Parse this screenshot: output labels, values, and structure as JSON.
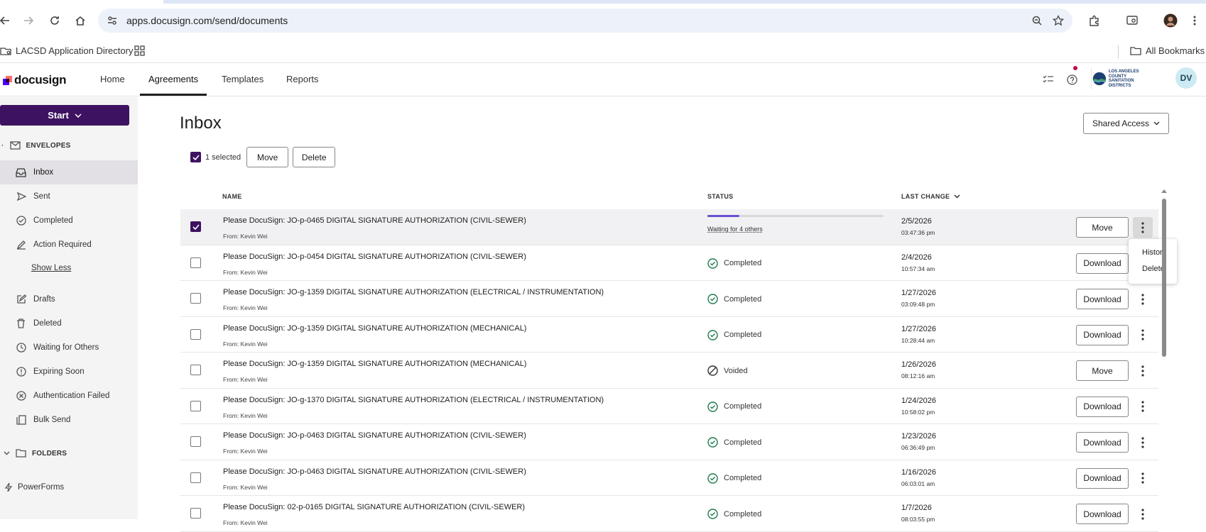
{
  "browser": {
    "url": "apps.docusign.com/send/documents"
  },
  "bookmarks": {
    "item1": "LACSD Application Directory",
    "all": "All Bookmarks"
  },
  "header": {
    "logo": "docusign",
    "tabs": [
      "Home",
      "Agreements",
      "Templates",
      "Reports"
    ],
    "org": [
      "LOS ANGELES COUNTY",
      "SANITATION DISTRICTS"
    ],
    "avatar": "DV"
  },
  "sidebar": {
    "start": "Start",
    "envelopes": "ENVELOPES",
    "items": [
      {
        "label": "Inbox",
        "icon": "inbox-icon",
        "active": true
      },
      {
        "label": "Sent",
        "icon": "send-icon"
      },
      {
        "label": "Completed",
        "icon": "check-circle-icon"
      },
      {
        "label": "Action Required",
        "icon": "pen-icon"
      }
    ],
    "show_less": "Show Less",
    "items2": [
      {
        "label": "Drafts",
        "icon": "edit-icon"
      },
      {
        "label": "Deleted",
        "icon": "trash-icon"
      },
      {
        "label": "Waiting for Others",
        "icon": "clock-icon"
      },
      {
        "label": "Expiring Soon",
        "icon": "alert-icon"
      },
      {
        "label": "Authentication Failed",
        "icon": "x-circle-icon"
      },
      {
        "label": "Bulk Send",
        "icon": "bulk-icon"
      }
    ],
    "folders": "FOLDERS",
    "powerforms": "PowerForms"
  },
  "main": {
    "title": "Inbox",
    "shared_access": "Shared Access",
    "selected_text": "1 selected",
    "bulk_move": "Move",
    "bulk_delete": "Delete",
    "columns": {
      "name": "NAME",
      "status": "STATUS",
      "last_change": "LAST CHANGE"
    },
    "rows": [
      {
        "name": "Please DocuSign: JO-p-0465 DIGITAL SIGNATURE AUTHORIZATION (CIVIL-SEWER)",
        "from": "From: Kevin Wei",
        "status": "Waiting for 4 others",
        "progress": 0.18,
        "date": "2/5/2026",
        "time": "03:47:36 pm",
        "action": "Move",
        "checked": true
      },
      {
        "name": "Please DocuSign: JO-p-0454 DIGITAL SIGNATURE AUTHORIZATION (CIVIL-SEWER)",
        "from": "From: Kevin Wei",
        "status": "Completed",
        "date": "2/4/2026",
        "time": "10:57:34 am",
        "action": "Download"
      },
      {
        "name": "Please DocuSign: JO-g-1359 DIGITAL SIGNATURE AUTHORIZATION (ELECTRICAL / INSTRUMENTATION)",
        "from": "From: Kevin Wei",
        "status": "Completed",
        "date": "1/27/2026",
        "time": "03:09:48 pm",
        "action": "Download"
      },
      {
        "name": "Please DocuSign: JO-g-1359 DIGITAL SIGNATURE AUTHORIZATION (MECHANICAL)",
        "from": "From: Kevin Wei",
        "status": "Completed",
        "date": "1/27/2026",
        "time": "10:28:44 am",
        "action": "Download"
      },
      {
        "name": "Please DocuSign: JO-g-1359 DIGITAL SIGNATURE AUTHORIZATION (MECHANICAL)",
        "from": "From: Kevin Wei",
        "status": "Voided",
        "date": "1/26/2026",
        "time": "08:12:16 am",
        "action": "Move"
      },
      {
        "name": "Please DocuSign: JO-g-1370 DIGITAL SIGNATURE AUTHORIZATION (ELECTRICAL / INSTRUMENTATION)",
        "from": "From: Kevin Wei",
        "status": "Completed",
        "date": "1/24/2026",
        "time": "10:58:02 pm",
        "action": "Download"
      },
      {
        "name": "Please DocuSign: JO-p-0463 DIGITAL SIGNATURE AUTHORIZATION (CIVIL-SEWER)",
        "from": "From: Kevin Wei",
        "status": "Completed",
        "date": "1/23/2026",
        "time": "06:36:49 pm",
        "action": "Download"
      },
      {
        "name": "Please DocuSign: JO-p-0463 DIGITAL SIGNATURE AUTHORIZATION (CIVIL-SEWER)",
        "from": "From: Kevin Wei",
        "status": "Completed",
        "date": "1/16/2026",
        "time": "06:03:01 am",
        "action": "Download"
      },
      {
        "name": "Please DocuSign: 02-p-0165 DIGITAL SIGNATURE AUTHORIZATION (CIVIL-SEWER)",
        "from": "From: Kevin Wei",
        "status": "Completed",
        "date": "1/7/2026",
        "time": "08:03:55 pm",
        "action": "Download"
      }
    ],
    "context_menu": [
      "History",
      "Delete"
    ]
  },
  "colors": {
    "brand": "#3d1260",
    "completed": "#1f7a4d",
    "progress": "#6c4fd1"
  }
}
